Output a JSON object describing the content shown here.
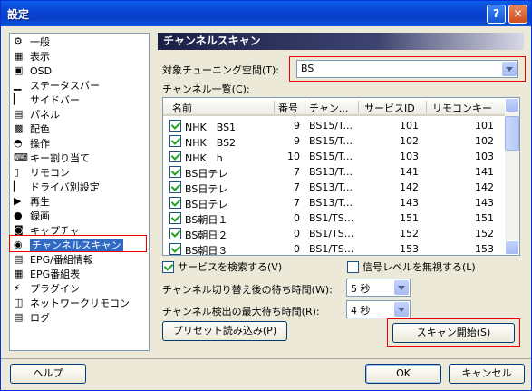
{
  "window": {
    "title": "設定"
  },
  "sidebar": {
    "items": [
      {
        "label": "一般",
        "icon": "gear-icon"
      },
      {
        "label": "表示",
        "icon": "monitor-icon"
      },
      {
        "label": "OSD",
        "icon": "osd-icon"
      },
      {
        "label": "ステータスバー",
        "icon": "statusbar-icon"
      },
      {
        "label": "サイドバー",
        "icon": "sidebar-icon"
      },
      {
        "label": "パネル",
        "icon": "panel-icon"
      },
      {
        "label": "配色",
        "icon": "palette-icon"
      },
      {
        "label": "操作",
        "icon": "mouse-icon"
      },
      {
        "label": "キー割り当て",
        "icon": "keyboard-icon"
      },
      {
        "label": "リモコン",
        "icon": "remote-icon"
      },
      {
        "label": "ドライバ別設定",
        "icon": "driver-icon"
      },
      {
        "label": "再生",
        "icon": "play-icon"
      },
      {
        "label": "録画",
        "icon": "record-icon"
      },
      {
        "label": "キャプチャ",
        "icon": "camera-icon"
      },
      {
        "label": "チャンネルスキャン",
        "icon": "antenna-icon",
        "selected": true
      },
      {
        "label": "EPG/番組情報",
        "icon": "epg-icon"
      },
      {
        "label": "EPG番組表",
        "icon": "epg-table-icon"
      },
      {
        "label": "プラグイン",
        "icon": "plugin-icon"
      },
      {
        "label": "ネットワークリモコン",
        "icon": "network-icon"
      },
      {
        "label": "ログ",
        "icon": "log-icon"
      }
    ]
  },
  "panel": {
    "title": "チャンネルスキャン",
    "space_label": "対象チューニング空間(T):",
    "space_value": "BS",
    "list_label": "チャンネル一覧(C):",
    "columns": [
      "名前",
      "番号",
      "チャン...",
      "サービスID",
      "リモコンキー"
    ],
    "rows": [
      {
        "checked": true,
        "name": "NHK　BS1",
        "number": "9",
        "channel": "BS15/T...",
        "service_id": "101",
        "remote_key": "101"
      },
      {
        "checked": true,
        "name": "NHK　BS2",
        "number": "9",
        "channel": "BS15/T...",
        "service_id": "102",
        "remote_key": "102"
      },
      {
        "checked": true,
        "name": "NHK　h",
        "number": "10",
        "channel": "BS15/T...",
        "service_id": "103",
        "remote_key": "103"
      },
      {
        "checked": true,
        "name": "BS日テレ",
        "number": "7",
        "channel": "BS13/T...",
        "service_id": "141",
        "remote_key": "141"
      },
      {
        "checked": true,
        "name": "BS日テレ",
        "number": "7",
        "channel": "BS13/T...",
        "service_id": "142",
        "remote_key": "142"
      },
      {
        "checked": true,
        "name": "BS日テレ",
        "number": "7",
        "channel": "BS13/T...",
        "service_id": "143",
        "remote_key": "143"
      },
      {
        "checked": true,
        "name": "BS朝日１",
        "number": "0",
        "channel": "BS1/TS...",
        "service_id": "151",
        "remote_key": "151"
      },
      {
        "checked": true,
        "name": "BS朝日２",
        "number": "0",
        "channel": "BS1/TS...",
        "service_id": "152",
        "remote_key": "152"
      },
      {
        "checked": true,
        "name": "BS朝日３",
        "number": "0",
        "channel": "BS1/TS...",
        "service_id": "153",
        "remote_key": "153"
      }
    ],
    "search_services_label": "サービスを検索する(V)",
    "search_services_checked": true,
    "ignore_signal_label": "信号レベルを無視する(L)",
    "ignore_signal_checked": false,
    "switch_wait_label": "チャンネル切り替え後の待ち時間(W):",
    "switch_wait_value": "5 秒",
    "detect_wait_label": "チャンネル検出の最大待ち時間(R):",
    "detect_wait_value": "4 秒",
    "preset_button": "プリセット読み込み(P)",
    "scan_button": "スキャン開始(S)"
  },
  "footer": {
    "help_button": "ヘルプ",
    "ok_button": "OK",
    "cancel_button": "キャンセル"
  },
  "colors": {
    "selection": "#316ac5",
    "highlight_box": "#ee0000",
    "header_gradient_start": "#1a1f48"
  }
}
